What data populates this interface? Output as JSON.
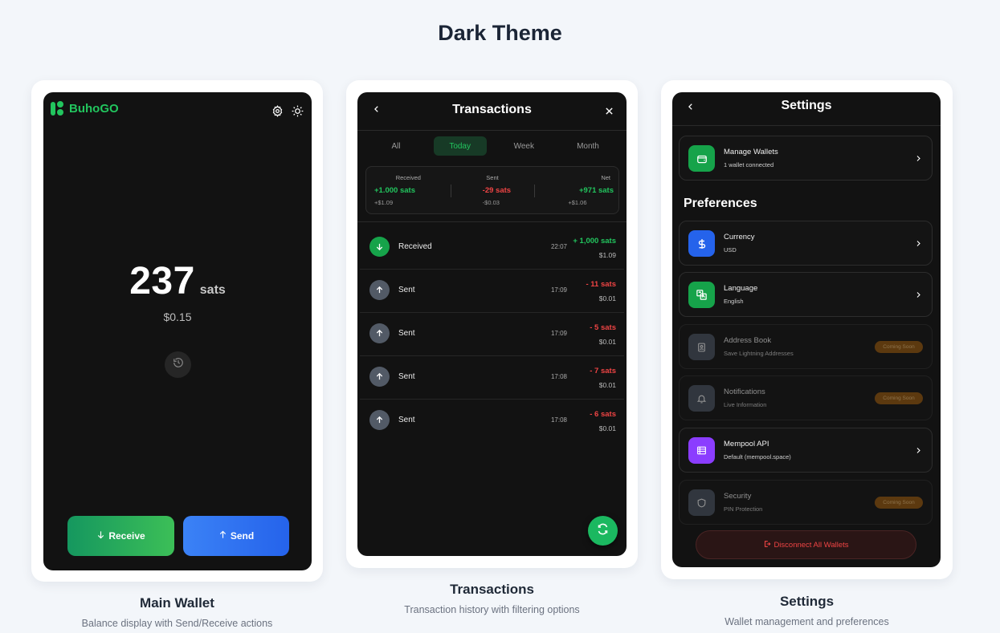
{
  "page": {
    "title": "Dark Theme"
  },
  "main_wallet": {
    "brand": "BuhoGO",
    "balance": "237",
    "unit": "sats",
    "fiat": "$0.15",
    "receive_label": "Receive",
    "send_label": "Send",
    "caption_title": "Main Wallet",
    "caption_sub": "Balance display with Send/Receive actions"
  },
  "transactions": {
    "title": "Transactions",
    "tabs": [
      {
        "label": "All"
      },
      {
        "label": "Today"
      },
      {
        "label": "Week"
      },
      {
        "label": "Month"
      }
    ],
    "active_tab": "Today",
    "summary": {
      "received": {
        "label": "Received",
        "value": "+1.000 sats",
        "fiat": "+$1.09"
      },
      "sent": {
        "label": "Sent",
        "value": "-29 sats",
        "fiat": "-$0.03"
      },
      "net": {
        "label": "Net",
        "value": "+971 sats",
        "fiat": "+$1.06"
      }
    },
    "rows": [
      {
        "name": "Received",
        "time": "22:07",
        "amount": "+ 1,000 sats",
        "fiat": "$1.09",
        "direction": "in"
      },
      {
        "name": "Sent",
        "time": "17:09",
        "amount": "- 11 sats",
        "fiat": "$0.01",
        "direction": "out"
      },
      {
        "name": "Sent",
        "time": "17:09",
        "amount": "- 5 sats",
        "fiat": "$0.01",
        "direction": "out"
      },
      {
        "name": "Sent",
        "time": "17:08",
        "amount": "- 7 sats",
        "fiat": "$0.01",
        "direction": "out"
      },
      {
        "name": "Sent",
        "time": "17:08",
        "amount": "- 6 sats",
        "fiat": "$0.01",
        "direction": "out"
      }
    ],
    "caption_title": "Transactions",
    "caption_sub": "Transaction history with filtering options"
  },
  "settings": {
    "title": "Settings",
    "manage_wallets": {
      "name": "Manage Wallets",
      "sub": "1 wallet connected",
      "icon": "wallet-icon",
      "color": "#16a34a"
    },
    "section_title": "Preferences",
    "items": [
      {
        "name": "Currency",
        "sub": "USD",
        "icon": "dollar-icon",
        "color": "#2563eb",
        "badge": ""
      },
      {
        "name": "Language",
        "sub": "English",
        "icon": "translate-icon",
        "color": "#16a34a",
        "badge": ""
      },
      {
        "name": "Address Book",
        "sub": "Save Lightning Addresses",
        "icon": "address-book-icon",
        "color": "#4b5563",
        "badge": "Coming Soon"
      },
      {
        "name": "Notifications",
        "sub": "Live Information",
        "icon": "bell-icon",
        "color": "#4b5563",
        "badge": "Coming Soon"
      },
      {
        "name": "Mempool API",
        "sub": "Default (mempool.space)",
        "icon": "server-icon",
        "color": "#8b3dff",
        "badge": ""
      },
      {
        "name": "Security",
        "sub": "PIN Protection",
        "icon": "shield-icon",
        "color": "#4b5563",
        "badge": "Coming Soon"
      }
    ],
    "disconnect_label": "Disconnect All Wallets",
    "caption_title": "Settings",
    "caption_sub": "Wallet management and preferences"
  },
  "colors": {
    "accent_green": "#22c55e",
    "accent_blue": "#2563eb",
    "negative_red": "#ef4444",
    "screen_bg": "#121212"
  }
}
